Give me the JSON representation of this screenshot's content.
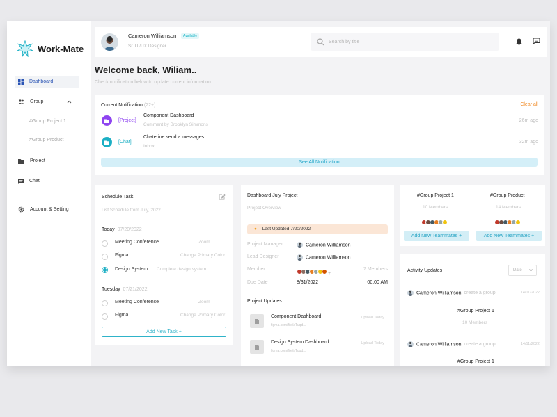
{
  "app": {
    "brand": "Work-Mate"
  },
  "colors": {
    "accent": "#1cafc4",
    "active_nav": "#2b55b5",
    "clear_all": "#f08a24",
    "project_tag": "#8e44f0",
    "chat_tag": "#1cafc4"
  },
  "sidebar": {
    "items": [
      {
        "label": "Dashboard",
        "icon": "dashboard-icon"
      },
      {
        "label": "Group",
        "icon": "group-icon"
      },
      {
        "label": "Project",
        "icon": "folder-icon"
      },
      {
        "label": "Chat",
        "icon": "chat-icon"
      },
      {
        "label": "Account & Setting",
        "icon": "gear-icon"
      }
    ],
    "sub_items": [
      "#Group Project 1",
      "#Group Product"
    ]
  },
  "header": {
    "user_name": "Cameron Williamson",
    "status": "Available",
    "role": "Sr. UI/UX Designer",
    "search_placeholder": "Search by title"
  },
  "welcome": {
    "title": "Welcome back, Wiliam..",
    "subtitle": "Check notification below to update current information"
  },
  "notifications": {
    "title": "Current Notification",
    "count": "(22+)",
    "clear_label": "Clear all",
    "items": [
      {
        "tag": "[Project]",
        "title": "Component Dashboard",
        "sub": "Comment by Brooklyn Simmons",
        "time": "26m ago"
      },
      {
        "tag": "[Chat]",
        "title": "Chaterine send a messages",
        "sub": "Inbox",
        "time": "32m ago"
      }
    ],
    "see_all": "See All Notification"
  },
  "schedule": {
    "title": "Schedule Task",
    "subtitle": "List Schedule from July, 2022",
    "days": [
      {
        "label": "Today",
        "date": "07/20/2022",
        "tasks": [
          {
            "name": "Meeting Conference",
            "note": "Zoom",
            "checked": false
          },
          {
            "name": "Figma",
            "note": "Change Primary Color",
            "checked": false
          },
          {
            "name": "Design System",
            "note": "Complete design system",
            "checked": true
          }
        ]
      },
      {
        "label": "Tuesday",
        "date": "07/21/2022",
        "tasks": [
          {
            "name": "Meeting Conference",
            "note": "Zoom",
            "checked": false
          },
          {
            "name": "Figma",
            "note": "Change Primary Color",
            "checked": false
          }
        ]
      }
    ],
    "add_label": "Add New Task  +"
  },
  "project": {
    "title": "Dashboard July Project",
    "subtitle": "Project Overview",
    "updated": "Last Updated 7/20/2022",
    "rows": [
      {
        "label": "Project Manager",
        "value": "Cameron Williamson"
      },
      {
        "label": "Lead Designer",
        "value": "Cameron Williamson"
      }
    ],
    "member_label": "Member",
    "member_count": "7 Members",
    "due_label": "Due Date",
    "due_date": "8/31/2022",
    "due_time": "00:00 AM",
    "updates_title": "Project Updates",
    "updates": [
      {
        "name": "Component Dashboard",
        "meta": "figma.com/file/aTuqd...",
        "time": "Upload Today"
      },
      {
        "name": "Design System Dashboard",
        "meta": "figma.com/file/aTuqd...",
        "time": "Upload Today"
      }
    ]
  },
  "groups": [
    {
      "name": "#Group Project 1",
      "members": "10 Members",
      "button": "Add New Teammates  +"
    },
    {
      "name": "#Group Product",
      "members": "14 Members",
      "button": "Add New Teammates  +"
    }
  ],
  "activity": {
    "title": "Activity Updates",
    "filter": "Date",
    "items": [
      {
        "user": "Cameron Williamson",
        "action": "create a group",
        "date": "14/11/2022",
        "group": "#Group Project 1",
        "members": "10 Members"
      },
      {
        "user": "Cameron Williamson",
        "action": "create a group",
        "date": "14/11/2022",
        "group": "#Group Project 1"
      }
    ]
  }
}
